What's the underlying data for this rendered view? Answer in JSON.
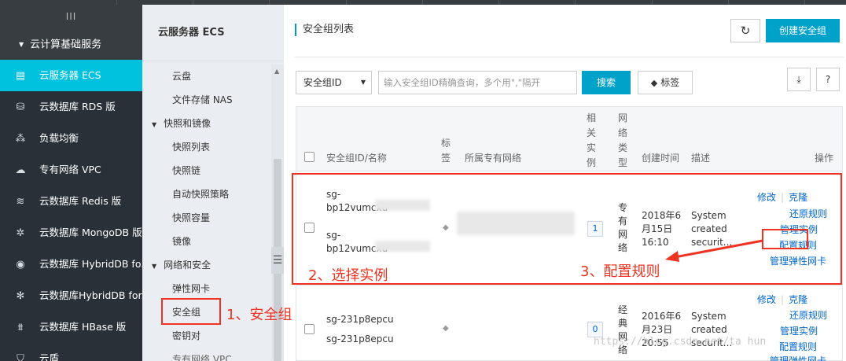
{
  "nav": {
    "collapse_label": "III",
    "group_label": "云计算基础服务",
    "items": [
      {
        "label": "云服务器 ECS",
        "icon": "server-icon",
        "glyph": "▤"
      },
      {
        "label": "云数据库 RDS 版",
        "icon": "database-icon",
        "glyph": "⛁"
      },
      {
        "label": "负载均衡",
        "icon": "load-balancer-icon",
        "glyph": "⁂"
      },
      {
        "label": "专有网络 VPC",
        "icon": "cloud-icon",
        "glyph": "☁"
      },
      {
        "label": "云数据库 Redis 版",
        "icon": "layers-icon",
        "glyph": "≋"
      },
      {
        "label": "云数据库 MongoDB 版",
        "icon": "gear-icon",
        "glyph": "✲"
      },
      {
        "label": "云数据库 HybridDB fo...",
        "icon": "eye-icon",
        "glyph": "◉"
      },
      {
        "label": "云数据库HybridDB for...",
        "icon": "network-icon",
        "glyph": "✻"
      },
      {
        "label": "云数据库 HBase 版",
        "icon": "hbase-icon",
        "glyph": "⩩"
      },
      {
        "label": "云盾",
        "icon": "shield-icon",
        "glyph": "⛉"
      }
    ]
  },
  "subnav": {
    "title": "云服务器 ECS",
    "toggle": "☰",
    "items": [
      {
        "type": "item",
        "label": "云盘"
      },
      {
        "type": "item",
        "label": "文件存储 NAS"
      },
      {
        "type": "head",
        "label": "快照和镜像"
      },
      {
        "type": "item",
        "label": "快照列表"
      },
      {
        "type": "item",
        "label": "快照链"
      },
      {
        "type": "item",
        "label": "自动快照策略"
      },
      {
        "type": "item",
        "label": "快照容量"
      },
      {
        "type": "item",
        "label": "镜像"
      },
      {
        "type": "head",
        "label": "网络和安全"
      },
      {
        "type": "item",
        "label": "弹性网卡"
      },
      {
        "type": "item",
        "label": "安全组"
      },
      {
        "type": "item",
        "label": "密钥对"
      },
      {
        "type": "item",
        "label": "专有网络 VPC"
      }
    ]
  },
  "main": {
    "page_title": "安全组列表",
    "refresh_glyph": "↻",
    "create_label": "创建安全组",
    "select_value": "安全组ID",
    "search_placeholder": "输入安全组ID精确查询，多个用\",\"隔开",
    "search_label": "搜索",
    "tag_label": "标签",
    "export_glyph": "⤓",
    "help_glyph": "?"
  },
  "table": {
    "headers": {
      "id_name": "安全组ID/名称",
      "tag": "标\n签",
      "vpc": "所属专有网络",
      "instances": "相\n关\n实\n例",
      "net_type": "网\n络\n类\n型",
      "created": "创建时间",
      "desc": "描述",
      "ops": "操作"
    },
    "rows": [
      {
        "id": "sg-\nbp12vumcxd",
        "name": "sg-\nbp12vumcxd",
        "count": "1",
        "net_type": "专\n有\n网\n络",
        "created": "2018年6\n月15日\n16:10",
        "desc": "System\ncreated\nsecurit...",
        "ops": {
          "modify": "修改",
          "clone": "克隆",
          "restore": "还原规则",
          "manage": "管理实例",
          "config": "配置规则",
          "eni": "管理弹性网卡"
        }
      },
      {
        "id": "sg-231p8epcu",
        "name": "sg-231p8epcu",
        "count": "0",
        "net_type": "经\n典\n网\n络",
        "created": "2016年6\n月23日\n20:55",
        "desc": "System\ncreated\nsecurit...",
        "ops": {
          "modify": "修改",
          "clone": "克隆",
          "restore": "还原规则",
          "manage": "管理实例",
          "config": "配置规则",
          "eni": "管理弹性网卡"
        }
      }
    ]
  },
  "annotations": {
    "step1": "1、安全组",
    "step2": "2、选择实例",
    "step3": "3、配置规则"
  },
  "watermark": "https://blog.csdn.net/ta    hun",
  "colors": {
    "accent": "#00c1de",
    "primary": "#00a2ca",
    "link": "#0066cc",
    "annotation": "#ee3322"
  }
}
